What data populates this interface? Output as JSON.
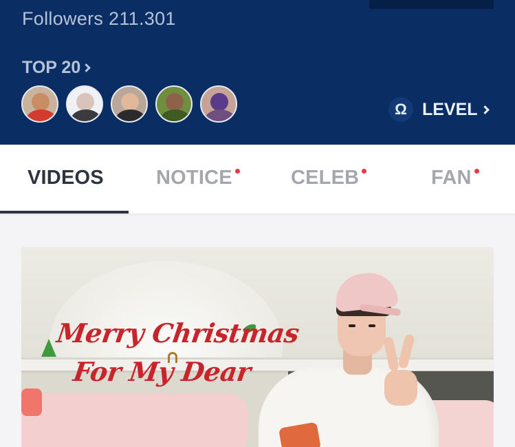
{
  "profile": {
    "followers_text": "Followers 211.301"
  },
  "top_fans": {
    "label": "TOP 20",
    "avatars": [
      "fan-avatar-1",
      "fan-avatar-2",
      "fan-avatar-3",
      "fan-avatar-4",
      "fan-avatar-5"
    ]
  },
  "level": {
    "icon": "omega-icon",
    "icon_glyph": "Ω",
    "label": "LEVEL"
  },
  "tabs": [
    {
      "label": "VIDEOS",
      "active": true,
      "has_dot": false
    },
    {
      "label": "NOTICE",
      "active": false,
      "has_dot": true
    },
    {
      "label": "CELEB",
      "active": false,
      "has_dot": true
    },
    {
      "label": "FAN",
      "active": false,
      "has_dot": true
    }
  ],
  "video": {
    "title_line1": "Merry Christmas",
    "title_line2": "For My Dear"
  },
  "colors": {
    "header_bg": "#0a2d63",
    "active_tab": "#2f3340",
    "inactive_tab": "#a4a7ae",
    "notification_dot": "#e83a43",
    "video_title": "#c8242b"
  }
}
